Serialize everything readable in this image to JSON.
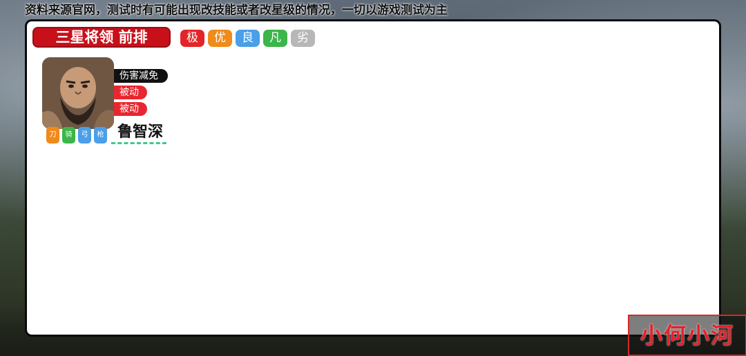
{
  "notice": "资料来源官网，测试时有可能出现改技能或者改星级的情况，一切以游戏测试为主",
  "title": "三星将领 前排",
  "tiers": [
    {
      "label": "极",
      "color": "#e32428"
    },
    {
      "label": "优",
      "color": "#f08a1a"
    },
    {
      "label": "良",
      "color": "#4a9fe8"
    },
    {
      "label": "凡",
      "color": "#3cb54a"
    },
    {
      "label": "劣",
      "color": "#b7b7b7"
    }
  ],
  "hero": {
    "name": "鲁智深",
    "skills": [
      "伤害减免",
      "被动",
      "被动"
    ],
    "weapons": [
      {
        "label": "刀",
        "color": "#f08a1a"
      },
      {
        "label": "骑",
        "color": "#3cb54a"
      },
      {
        "label": "弓",
        "color": "#4a9fe8"
      },
      {
        "label": "枪",
        "color": "#4a9fe8"
      }
    ]
  },
  "watermark": "小何小河"
}
